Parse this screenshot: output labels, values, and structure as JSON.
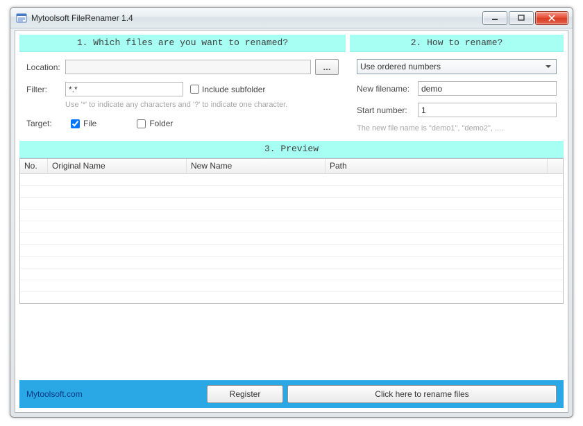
{
  "window": {
    "title": "Mytoolsoft FileRenamer 1.4"
  },
  "section1": {
    "header": "1. Which files are you want to renamed?",
    "location_label": "Location:",
    "location_value": "",
    "browse_label": "...",
    "filter_label": "Filter:",
    "filter_value": "*.*",
    "include_subfolder_label": "Include subfolder",
    "filter_hint": "Use '*' to indicate any characters and '?' to indicate one character.",
    "target_label": "Target:",
    "target_file_label": "File",
    "target_folder_label": "Folder",
    "target_file_checked": true,
    "target_folder_checked": false
  },
  "section2": {
    "header": "2. How to rename?",
    "method_selected": "Use ordered numbers",
    "new_filename_label": "New filename:",
    "new_filename_value": "demo",
    "start_number_label": "Start number:",
    "start_number_value": "1",
    "hint": "The new file name is \"demo1\", \"demo2\", ...."
  },
  "preview": {
    "header": "3. Preview",
    "columns": {
      "no": "No.",
      "original": "Original Name",
      "newname": "New Name",
      "path": "Path"
    }
  },
  "footer": {
    "brand": "Mytoolsoft.com",
    "register": "Register",
    "rename": "Click here to rename files"
  }
}
